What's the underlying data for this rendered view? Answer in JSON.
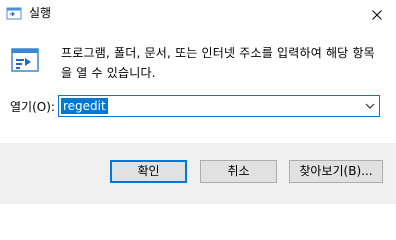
{
  "window": {
    "title": "실행"
  },
  "description": "프로그램, 폴더, 문서, 또는 인터넷 주소를 입력하여 해당 항목을 열 수 있습니다.",
  "open_field": {
    "label": "열기(O):",
    "value": "regedit"
  },
  "buttons": {
    "ok": "확인",
    "cancel": "취소",
    "browse": "찾아보기(B)..."
  },
  "colors": {
    "accent": "#0078d7",
    "footer_bg": "#f0f0f0",
    "button_bg": "#e1e1e1"
  }
}
